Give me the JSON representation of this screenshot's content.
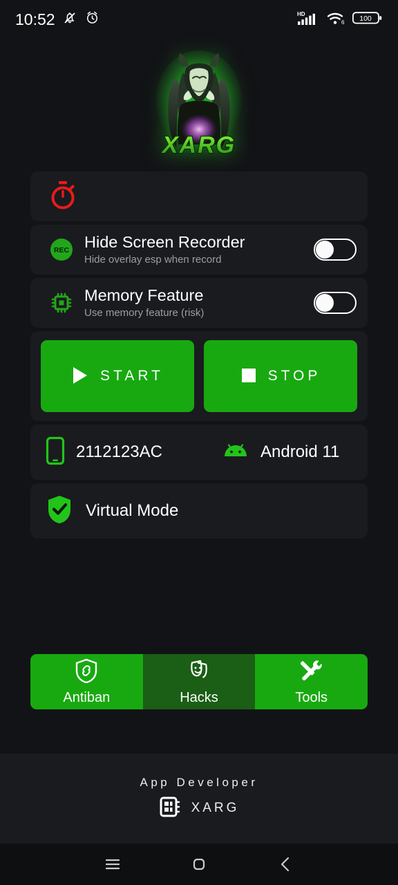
{
  "statusbar": {
    "time": "10:52",
    "left_icons": [
      "bell-muted-icon",
      "alarm-clock-icon"
    ],
    "network_label": "HD",
    "wifi_label": "6",
    "battery_level": "100"
  },
  "logo": {
    "name": "xarg-logo",
    "wordmark": "XARG",
    "glow_color": "#28dc28"
  },
  "timer_card": {
    "icon": "stopwatch-icon",
    "icon_color": "#e81b1b"
  },
  "settings": [
    {
      "icon": "rec-badge-icon",
      "title": "Hide Screen Recorder",
      "subtitle": "Hide overlay esp when record",
      "toggle_state": "off"
    },
    {
      "icon": "memory-chip-icon",
      "title": "Memory Feature",
      "subtitle": "Use memory feature (risk)",
      "toggle_state": "off"
    }
  ],
  "actions": {
    "start_label": "START",
    "start_icon": "play-icon",
    "stop_label": "STOP",
    "stop_icon": "square-stop-icon",
    "button_color": "#18a911"
  },
  "device": {
    "phone_icon": "smartphone-icon",
    "model": "2112123AC",
    "android_icon": "android-robot-icon",
    "os_version": "Android 11"
  },
  "virtual_mode": {
    "icon": "shield-check-icon",
    "label": "Virtual Mode"
  },
  "tabs": [
    {
      "icon": "shield-link-icon",
      "label": "Antiban",
      "selected": true
    },
    {
      "icon": "theater-masks-icon",
      "label": "Hacks",
      "selected": false
    },
    {
      "icon": "tools-icon",
      "label": "Tools",
      "selected": true
    }
  ],
  "footer": {
    "title": "App Developer",
    "icon": "chip-grid-icon",
    "developer": "XARG"
  },
  "navbar": {
    "recents": "menu-icon",
    "home": "home-square-icon",
    "back": "chevron-left-icon"
  },
  "colors": {
    "background": "#121316",
    "card": "#1a1b1f",
    "accent_green": "#18a911",
    "dim_green": "#1b5e15",
    "red": "#e81b1b"
  }
}
